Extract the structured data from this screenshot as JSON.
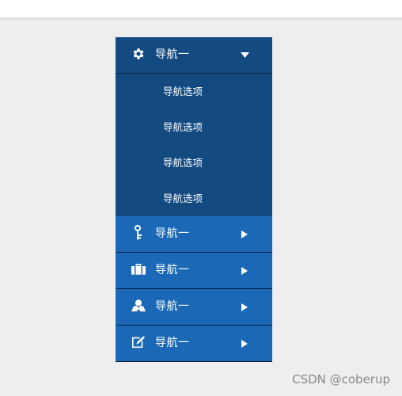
{
  "nav": {
    "items": [
      {
        "label": "导航一",
        "icon": "gear-icon",
        "arrow": "chevron-down-icon",
        "expanded": true,
        "children": [
          "导航选项",
          "导航选项",
          "导航选项",
          "导航选项"
        ]
      },
      {
        "label": "导航一",
        "icon": "key-icon",
        "arrow": "chevron-right-icon"
      },
      {
        "label": "导航一",
        "icon": "briefcase-icon",
        "arrow": "chevron-right-icon"
      },
      {
        "label": "导航一",
        "icon": "user-icon",
        "arrow": "chevron-right-icon"
      },
      {
        "label": "导航一",
        "icon": "edit-icon",
        "arrow": "chevron-right-icon"
      }
    ]
  },
  "colors": {
    "expanded_bg": "#134a80",
    "item_bg": "#1b69b6",
    "divider": "#0b1f3a",
    "page_bg": "#eeeeee"
  },
  "watermark": "CSDN @coberup"
}
